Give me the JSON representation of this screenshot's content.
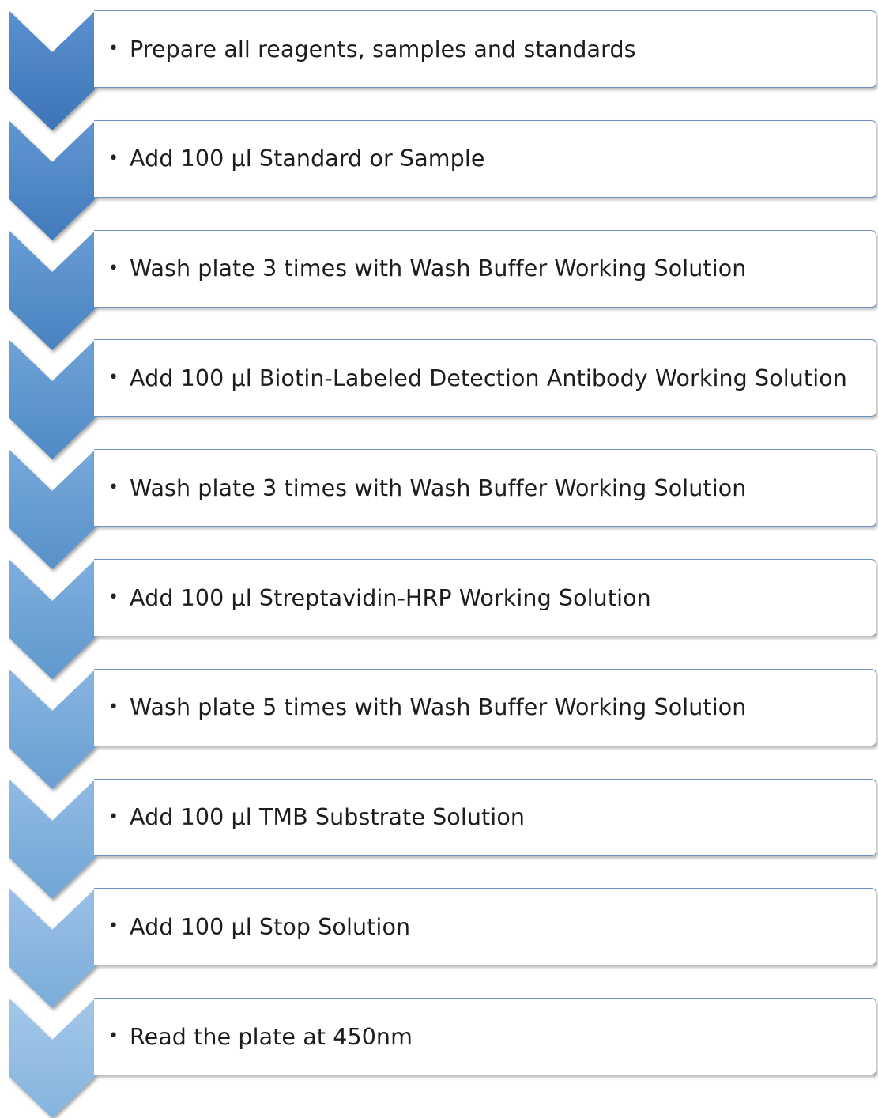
{
  "steps": [
    {
      "label": "Prepare all reagents, samples and standards",
      "color_top": "#5a90cf",
      "color_bottom": "#3c74b6"
    },
    {
      "label": "Add 100 µl Standard or Sample",
      "color_top": "#6096d2",
      "color_bottom": "#427bbb"
    },
    {
      "label": "Wash plate 3 times with Wash Buffer Working Solution",
      "color_top": "#679cd5",
      "color_bottom": "#4983c0"
    },
    {
      "label": "Add 100 µl Biotin-Labeled Detection Antibody Working Solution",
      "color_top": "#6ea2d8",
      "color_bottom": "#508ac5"
    },
    {
      "label": "Wash plate 3 times with Wash Buffer Working Solution",
      "color_top": "#76a8db",
      "color_bottom": "#5891c9"
    },
    {
      "label": "Add 100 µl Streptavidin-HRP Working Solution",
      "color_top": "#7eaede",
      "color_bottom": "#6098cd"
    },
    {
      "label": "Wash plate 5 times with Wash Buffer Working Solution",
      "color_top": "#87b4e1",
      "color_bottom": "#699fd1"
    },
    {
      "label": "Add 100 µl TMB Substrate Solution",
      "color_top": "#90bae4",
      "color_bottom": "#72a6d5"
    },
    {
      "label": "Add 100 µl Stop Solution",
      "color_top": "#99c0e7",
      "color_bottom": "#7badd8"
    },
    {
      "label": "Read the plate at 450nm",
      "color_top": "#a3c7ea",
      "color_bottom": "#85b4dc"
    }
  ]
}
